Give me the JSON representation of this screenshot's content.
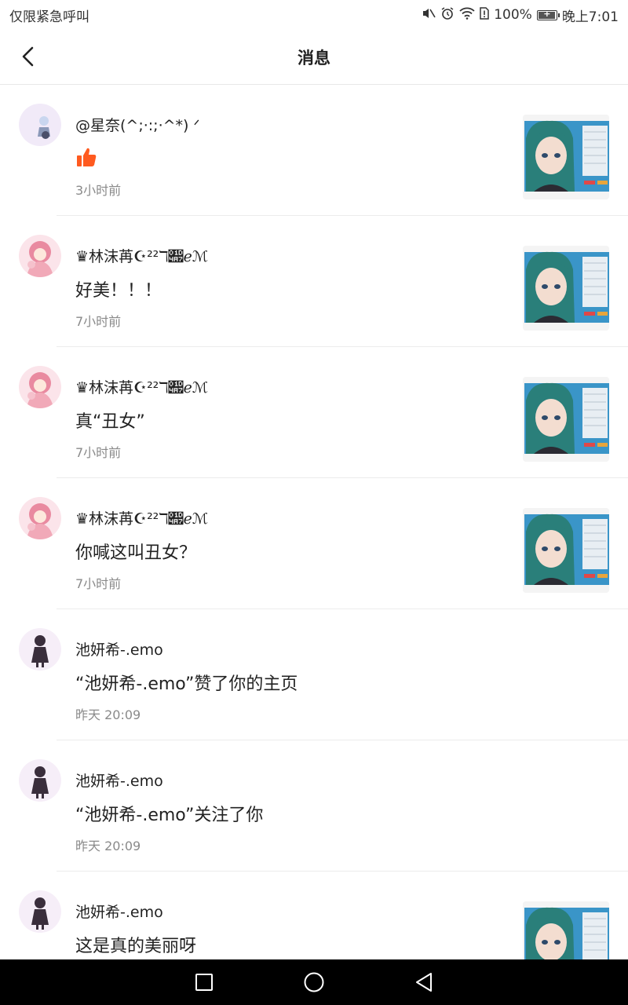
{
  "status_bar": {
    "left_text": "仅限紧急呼叫",
    "battery_percent": "100%",
    "time": "晚上7:01",
    "battery_level": 1.0,
    "icons": [
      "mute-icon",
      "alarm-icon",
      "wifi-icon",
      "sim-alert-icon",
      "battery-icon"
    ]
  },
  "header": {
    "title": "消息",
    "back_icon": "back-arrow-icon"
  },
  "messages": [
    {
      "username": "@星奈(^;·:;·^*) ᐟ",
      "message": "",
      "has_like": true,
      "time": "3小时前",
      "avatar": "avatar-anime-girl-1",
      "has_thumb": true
    },
    {
      "username": "♛林沫苒☪︎²²ℸ𝒧ℯℳ",
      "message": "好美！！！",
      "has_like": false,
      "time": "7小时前",
      "avatar": "avatar-anime-girl-pink",
      "has_thumb": true
    },
    {
      "username": "♛林沫苒☪︎²²ℸ𝒧ℯℳ",
      "message": "真“丑女”",
      "has_like": false,
      "time": "7小时前",
      "avatar": "avatar-anime-girl-pink",
      "has_thumb": true
    },
    {
      "username": "♛林沫苒☪︎²²ℸ𝒧ℯℳ",
      "message": "你喊这叫丑女？",
      "has_like": false,
      "time": "7小时前",
      "avatar": "avatar-anime-girl-pink",
      "has_thumb": true
    },
    {
      "username": "池妍希-.emo",
      "message": "“池妍希-.emo”赞了你的主页",
      "has_like": false,
      "time": "昨天 20:09",
      "avatar": "avatar-chibi-dark",
      "has_thumb": false
    },
    {
      "username": "池妍希-.emo",
      "message": "“池妍希-.emo”关注了你",
      "has_like": false,
      "time": "昨天 20:09",
      "avatar": "avatar-chibi-dark",
      "has_thumb": false
    },
    {
      "username": "池妍希-.emo",
      "message": "这是真的美丽呀",
      "has_like": false,
      "time": "",
      "avatar": "avatar-chibi-dark",
      "has_thumb": true
    }
  ],
  "nav_bar": {
    "icons": [
      "recents-square-icon",
      "home-circle-icon",
      "back-triangle-icon"
    ]
  },
  "colors": {
    "like": "#ff5a1f",
    "thumb_bg": "#3a95c8",
    "hair": "#2a7f7a",
    "time_text": "#8a8a8a"
  }
}
